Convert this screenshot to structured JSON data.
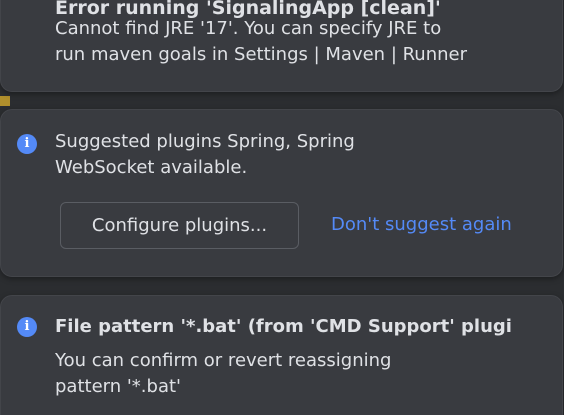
{
  "notifications": [
    {
      "type": "error",
      "icon": "error-icon",
      "title": "Error running 'SignalingApp [clean]'",
      "message": "Cannot find JRE '17'. You can specify JRE to\nrun maven goals in Settings | Maven | Runner"
    },
    {
      "type": "info",
      "icon": "info-icon",
      "message": "Suggested plugins Spring, Spring\nWebSocket available.",
      "primary_action": "Configure plugins...",
      "secondary_action": "Don't suggest again"
    },
    {
      "type": "info",
      "icon": "info-icon",
      "title": "File pattern '*.bat' (from 'CMD Support' plugi",
      "message": "You can confirm or revert reassigning\npattern '*.bat'"
    }
  ],
  "colors": {
    "background": "#2b2d30",
    "card": "#393b40",
    "text": "#dfe1e5",
    "link": "#548af7",
    "info_icon": "#548af7",
    "error_icon": "#db5c5c"
  }
}
